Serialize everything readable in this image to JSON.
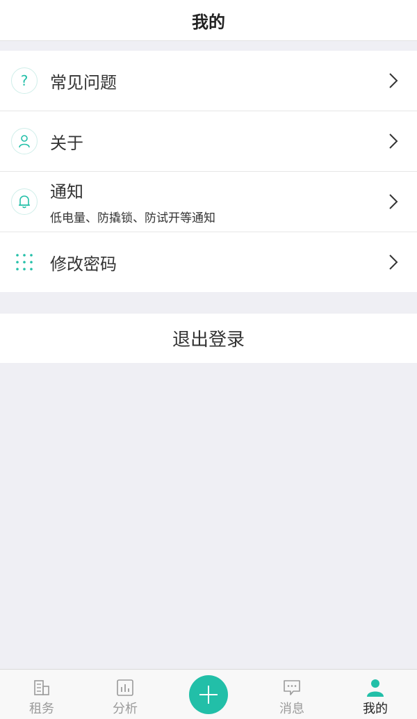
{
  "header": {
    "title": "我的"
  },
  "menu": {
    "items": [
      {
        "label": "常见问题",
        "icon": "question-icon"
      },
      {
        "label": "关于",
        "icon": "user-icon"
      },
      {
        "label": "通知",
        "sub": "低电量、防撬锁、防试开等通知",
        "icon": "bell-icon"
      },
      {
        "label": "修改密码",
        "icon": "keypad-icon"
      }
    ]
  },
  "logout": {
    "label": "退出登录"
  },
  "tabbar": {
    "tabs": [
      {
        "label": "租务",
        "icon": "building-icon"
      },
      {
        "label": "分析",
        "icon": "chart-icon"
      },
      {
        "label": "",
        "icon": "add-icon"
      },
      {
        "label": "消息",
        "icon": "message-icon"
      },
      {
        "label": "我的",
        "icon": "profile-icon",
        "active": true
      }
    ]
  },
  "colors": {
    "accent": "#22bfa8",
    "background": "#efeff4"
  }
}
